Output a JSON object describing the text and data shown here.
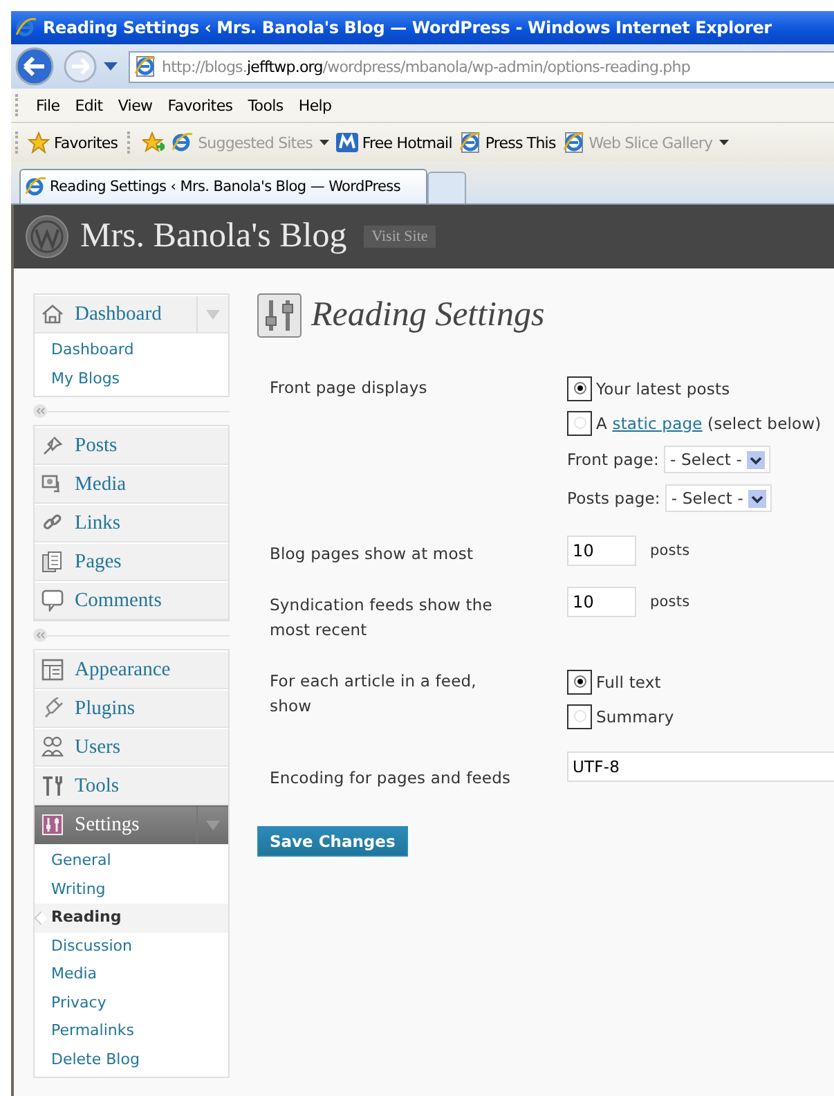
{
  "window": {
    "title": "Reading Settings ‹ Mrs. Banola's Blog — WordPress - Windows Internet Explorer"
  },
  "address_bar": {
    "url_parts": [
      {
        "text": "http://blogs.",
        "emphasis": false
      },
      {
        "text": "jefftwp.org",
        "emphasis": true
      },
      {
        "text": "/wordpress/mbanola/wp-admin/options-reading.php",
        "emphasis": false
      }
    ]
  },
  "menu_bar": [
    "File",
    "Edit",
    "View",
    "Favorites",
    "Tools",
    "Help"
  ],
  "favorites_bar": [
    {
      "kind": "favorites",
      "label": "Favorites",
      "dimmed": false,
      "dropdown": false
    },
    {
      "kind": "add",
      "dimmed": false,
      "dropdown": false
    },
    {
      "kind": "ie",
      "label": "Suggested Sites",
      "dimmed": true,
      "dropdown": true
    },
    {
      "kind": "hotmail",
      "label": "Free Hotmail",
      "dimmed": false,
      "dropdown": false
    },
    {
      "kind": "page",
      "label": "Press This",
      "dimmed": false,
      "dropdown": false
    },
    {
      "kind": "page",
      "label": "Web Slice Gallery",
      "dimmed": true,
      "dropdown": true
    }
  ],
  "tabs": [
    {
      "label": "Reading Settings ‹ Mrs. Banola's Blog — WordPress",
      "selected": true
    }
  ],
  "site": {
    "title": "Mrs. Banola's Blog",
    "visit_button": "Visit Site"
  },
  "sidebar": {
    "groups": [
      {
        "items": [
          {
            "label": "Dashboard",
            "kind": "house",
            "current": false,
            "expanded": true,
            "children": [
              {
                "label": "Dashboard",
                "selected": false
              },
              {
                "label": "My Blogs",
                "selected": false
              }
            ]
          }
        ]
      },
      {
        "items": [
          {
            "label": "Posts",
            "kind": "pin",
            "current": false,
            "expanded": false
          },
          {
            "label": "Media",
            "kind": "media",
            "current": false,
            "expanded": false
          },
          {
            "label": "Links",
            "kind": "link",
            "current": false,
            "expanded": false
          },
          {
            "label": "Pages",
            "kind": "pages",
            "current": false,
            "expanded": false
          },
          {
            "label": "Comments",
            "kind": "comment",
            "current": false,
            "expanded": false
          }
        ]
      },
      {
        "items": [
          {
            "label": "Appearance",
            "kind": "layout",
            "current": false,
            "expanded": false
          },
          {
            "label": "Plugins",
            "kind": "plug",
            "current": false,
            "expanded": false
          },
          {
            "label": "Users",
            "kind": "users",
            "current": false,
            "expanded": false
          },
          {
            "label": "Tools",
            "kind": "tools",
            "current": false,
            "expanded": false
          },
          {
            "label": "Settings",
            "kind": "settings",
            "current": true,
            "expanded": true,
            "children": [
              {
                "label": "General",
                "selected": false
              },
              {
                "label": "Writing",
                "selected": false
              },
              {
                "label": "Reading",
                "selected": true
              },
              {
                "label": "Discussion",
                "selected": false
              },
              {
                "label": "Media",
                "selected": false
              },
              {
                "label": "Privacy",
                "selected": false
              },
              {
                "label": "Permalinks",
                "selected": false
              },
              {
                "label": "Delete Blog",
                "selected": false
              }
            ]
          }
        ]
      }
    ]
  },
  "page": {
    "title": "Reading Settings",
    "rows": [
      {
        "kind": "radios",
        "label": "Front page displays",
        "options": [
          {
            "text": "Your latest posts",
            "selected": true
          },
          {
            "prefix": "A",
            "link": "static page",
            "suffix": "(select below)",
            "selected": false
          }
        ],
        "selects": [
          {
            "label": "Front page:",
            "value": "- Select -"
          },
          {
            "label": "Posts page:",
            "value": "- Select -"
          }
        ]
      },
      {
        "kind": "number",
        "label": "Blog pages show at most",
        "value": "10",
        "unit": "posts"
      },
      {
        "kind": "number",
        "label": "Syndication feeds show the most recent",
        "value": "10",
        "unit": "posts"
      },
      {
        "kind": "radios",
        "label": "For each article in a feed, show",
        "options": [
          {
            "text": "Full text",
            "selected": true
          },
          {
            "text": "Summary",
            "selected": false
          }
        ]
      },
      {
        "kind": "text",
        "label": "Encoding for pages and feeds",
        "value": "UTF-8"
      }
    ],
    "save_button": "Save Changes"
  }
}
